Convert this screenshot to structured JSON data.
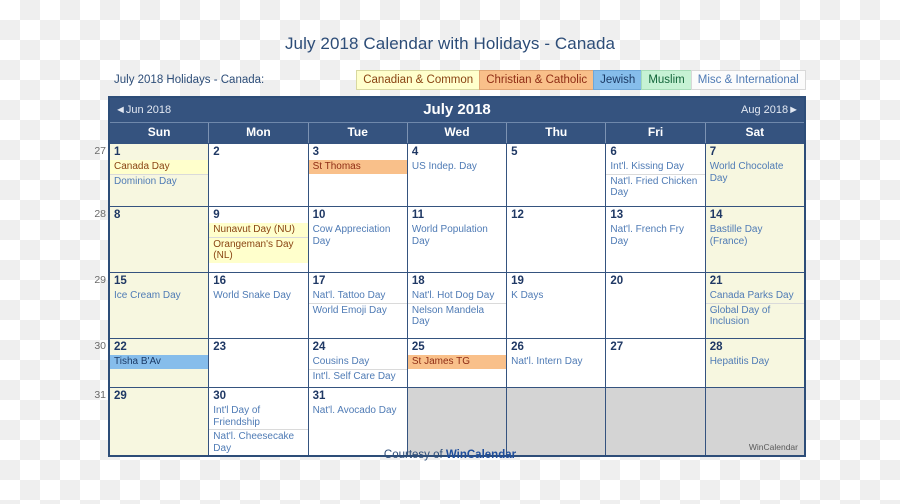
{
  "title": "July 2018 Calendar with Holidays - Canada",
  "legend": {
    "label": "July 2018 Holidays - Canada:",
    "chips": [
      {
        "label": "Canadian & Common",
        "key": "canadian",
        "color": "#ffffcc"
      },
      {
        "label": "Christian & Catholic",
        "key": "christian",
        "color": "#f9c08a"
      },
      {
        "label": "Jewish",
        "key": "jewish",
        "color": "#86bdeb"
      },
      {
        "label": "Muslim",
        "key": "muslim",
        "color": "#c6f2d4"
      },
      {
        "label": "Misc & International",
        "key": "misc",
        "color": "#fbfbfb"
      }
    ]
  },
  "calendar": {
    "month_label": "July 2018",
    "prev_label": "◄Jun 2018",
    "next_label": "Aug 2018►",
    "weekdays": [
      "Sun",
      "Mon",
      "Tue",
      "Wed",
      "Thu",
      "Fri",
      "Sat"
    ],
    "week_numbers": [
      "27",
      "28",
      "29",
      "30",
      "31"
    ],
    "watermark": "WinCalendar",
    "weeks": [
      {
        "num": "27",
        "days": [
          {
            "num": "1",
            "weekend": true,
            "events": [
              {
                "text": "Canada Day",
                "cat": "canadian"
              },
              {
                "text": "Dominion Day",
                "cat": "misc"
              }
            ]
          },
          {
            "num": "2",
            "weekend": false,
            "events": []
          },
          {
            "num": "3",
            "weekend": false,
            "events": [
              {
                "text": "St Thomas",
                "cat": "christian"
              }
            ]
          },
          {
            "num": "4",
            "weekend": false,
            "events": [
              {
                "text": "US Indep. Day",
                "cat": "misc"
              }
            ]
          },
          {
            "num": "5",
            "weekend": false,
            "events": []
          },
          {
            "num": "6",
            "weekend": false,
            "events": [
              {
                "text": "Int'l. Kissing Day",
                "cat": "misc"
              },
              {
                "text": "Nat'l. Fried Chicken Day",
                "cat": "misc"
              }
            ]
          },
          {
            "num": "7",
            "weekend": true,
            "events": [
              {
                "text": "World Chocolate Day",
                "cat": "misc"
              }
            ]
          }
        ]
      },
      {
        "num": "28",
        "days": [
          {
            "num": "8",
            "weekend": true,
            "events": []
          },
          {
            "num": "9",
            "weekend": false,
            "events": [
              {
                "text": "Nunavut Day (NU)",
                "cat": "canadian"
              },
              {
                "text": "Orangeman's Day (NL)",
                "cat": "canadian"
              }
            ]
          },
          {
            "num": "10",
            "weekend": false,
            "events": [
              {
                "text": "Cow Appreciation Day",
                "cat": "misc"
              }
            ]
          },
          {
            "num": "11",
            "weekend": false,
            "events": [
              {
                "text": "World Population Day",
                "cat": "misc"
              }
            ]
          },
          {
            "num": "12",
            "weekend": false,
            "events": []
          },
          {
            "num": "13",
            "weekend": false,
            "events": [
              {
                "text": "Nat'l. French Fry Day",
                "cat": "misc"
              }
            ]
          },
          {
            "num": "14",
            "weekend": true,
            "events": [
              {
                "text": "Bastille Day (France)",
                "cat": "misc"
              }
            ]
          }
        ]
      },
      {
        "num": "29",
        "days": [
          {
            "num": "15",
            "weekend": true,
            "events": [
              {
                "text": "Ice Cream Day",
                "cat": "misc"
              }
            ]
          },
          {
            "num": "16",
            "weekend": false,
            "events": [
              {
                "text": "World Snake Day",
                "cat": "misc"
              }
            ]
          },
          {
            "num": "17",
            "weekend": false,
            "events": [
              {
                "text": "Nat'l. Tattoo Day",
                "cat": "misc"
              },
              {
                "text": "World Emoji Day",
                "cat": "misc"
              }
            ]
          },
          {
            "num": "18",
            "weekend": false,
            "events": [
              {
                "text": "Nat'l. Hot Dog Day",
                "cat": "misc"
              },
              {
                "text": "Nelson Mandela Day",
                "cat": "misc"
              }
            ]
          },
          {
            "num": "19",
            "weekend": false,
            "events": [
              {
                "text": "K Days",
                "cat": "misc"
              }
            ]
          },
          {
            "num": "20",
            "weekend": false,
            "events": []
          },
          {
            "num": "21",
            "weekend": true,
            "events": [
              {
                "text": "Canada Parks Day",
                "cat": "misc"
              },
              {
                "text": "Global Day of Inclusion",
                "cat": "misc"
              }
            ]
          }
        ]
      },
      {
        "num": "30",
        "days": [
          {
            "num": "22",
            "weekend": true,
            "events": [
              {
                "text": "Tisha B'Av",
                "cat": "jewish"
              }
            ]
          },
          {
            "num": "23",
            "weekend": false,
            "events": []
          },
          {
            "num": "24",
            "weekend": false,
            "events": [
              {
                "text": "Cousins Day",
                "cat": "misc"
              },
              {
                "text": "Int'l. Self Care Day",
                "cat": "misc"
              }
            ]
          },
          {
            "num": "25",
            "weekend": false,
            "events": [
              {
                "text": "St James TG",
                "cat": "christian"
              }
            ]
          },
          {
            "num": "26",
            "weekend": false,
            "events": [
              {
                "text": "Nat'l. Intern Day",
                "cat": "misc"
              }
            ]
          },
          {
            "num": "27",
            "weekend": false,
            "events": []
          },
          {
            "num": "28",
            "weekend": true,
            "events": [
              {
                "text": "Hepatitis Day",
                "cat": "misc"
              }
            ]
          }
        ]
      },
      {
        "num": "31",
        "days": [
          {
            "num": "29",
            "weekend": true,
            "events": []
          },
          {
            "num": "30",
            "weekend": false,
            "events": [
              {
                "text": "Int'l Day of Friendship",
                "cat": "misc"
              },
              {
                "text": "Nat'l. Cheesecake Day",
                "cat": "misc"
              }
            ]
          },
          {
            "num": "31",
            "weekend": false,
            "events": [
              {
                "text": "Nat'l. Avocado Day",
                "cat": "misc"
              }
            ]
          },
          {
            "num": "",
            "weekend": false,
            "blank": true,
            "events": []
          },
          {
            "num": "",
            "weekend": false,
            "blank": true,
            "events": []
          },
          {
            "num": "",
            "weekend": false,
            "blank": true,
            "events": []
          },
          {
            "num": "",
            "weekend": false,
            "blank": true,
            "events": []
          }
        ]
      }
    ]
  },
  "footer": {
    "prefix": "Courtesy of ",
    "brand": "WinCalendar"
  }
}
